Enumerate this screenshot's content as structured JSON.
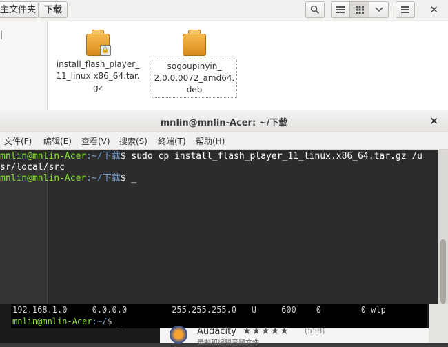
{
  "file_manager": {
    "breadcrumb": [
      "主文件夹",
      "下载"
    ],
    "toolbar_icons": [
      "search-icon",
      "list-view-icon",
      "grid-view-icon",
      "chevron-down-icon",
      "menu-icon",
      "close-icon"
    ],
    "files": [
      {
        "name": "install_flash_player_\n11_linux.x86_64.tar.\ngz",
        "icon": "package-locked-icon"
      },
      {
        "name": "sogoupinyin_\n2.0.0.0072_amd64.\ndeb",
        "icon": "package-icon"
      }
    ]
  },
  "terminal": {
    "title": "mnlin@mnlin-Acer: ~/下载",
    "close": "×",
    "menu": [
      "文件(F)",
      "编辑(E)",
      "查看(V)",
      "搜索(S)",
      "终端(T)",
      "帮助(H)"
    ],
    "lines": [
      {
        "user": "mnlin@mnlin-Acer",
        "path": ":~/下载",
        "cmd": "$ sudo cp install_flash_player_11_linux.x86_64.tar.gz /u"
      },
      {
        "text": "sr/local/src"
      },
      {
        "user": "mnlin@mnlin-Acer",
        "path": ":~/下载",
        "cmd": "$ _"
      }
    ]
  },
  "background_terminal": {
    "route_line": "192.168.1.0     0.0.0.0         255.255.255.0   U     600    0        0 wlp",
    "prompt_user": "mnlin@mnlin-Acer",
    "prompt_path": ":~/",
    "prompt_cmd": "$ _"
  },
  "software_center": {
    "app_name": "Audacity",
    "stars": "★★★★★",
    "rating_count": "(558)",
    "desc": "录制和编辑音频文件"
  }
}
